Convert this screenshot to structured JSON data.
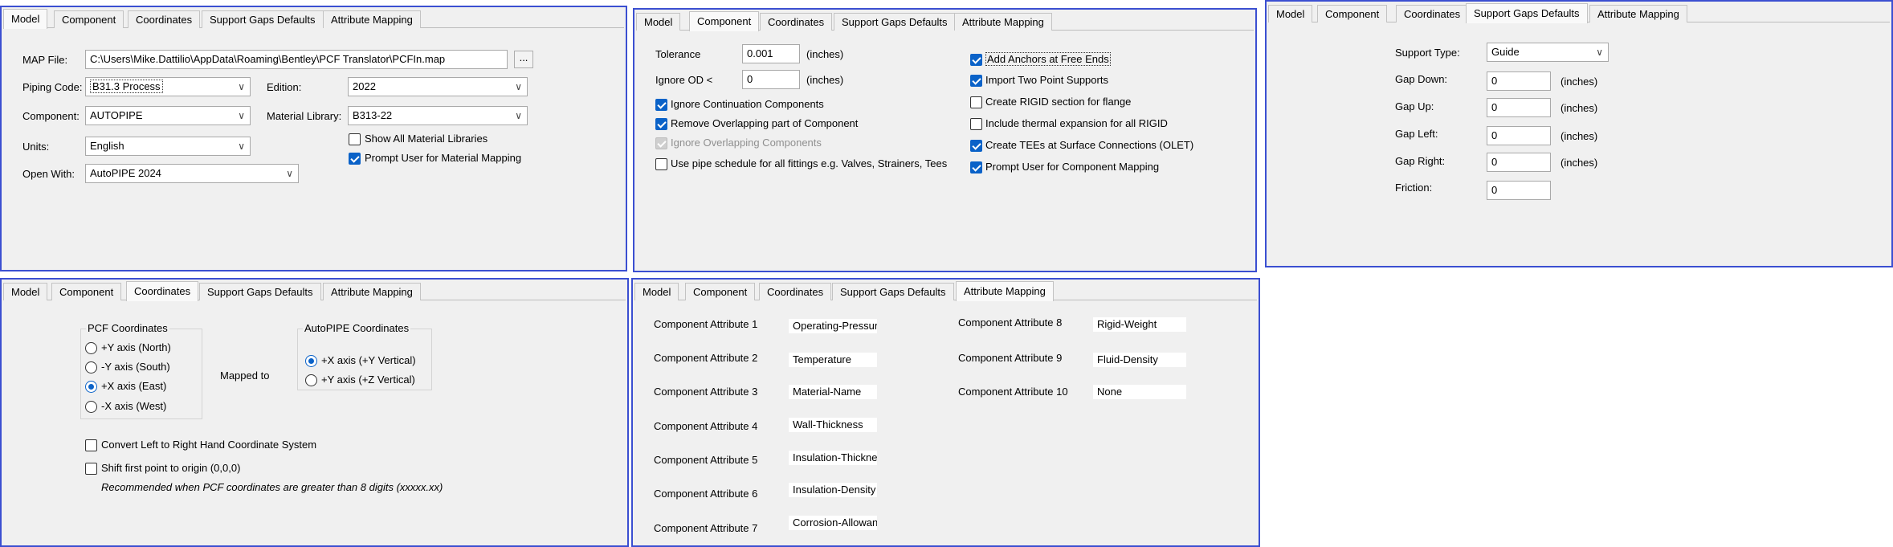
{
  "tabs": [
    "Model",
    "Component",
    "Coordinates",
    "Support Gaps Defaults",
    "Attribute Mapping"
  ],
  "model": {
    "map_file_label": "MAP File:",
    "map_file_value": "C:\\Users\\Mike.Dattilio\\AppData\\Roaming\\Bentley\\PCF Translator\\PCFIn.map",
    "browse_label": "...",
    "piping_code_label": "Piping Code:",
    "piping_code_value": "B31.3 Process",
    "edition_label": "Edition:",
    "edition_value": "2022",
    "component_label": "Component:",
    "component_value": "AUTOPIPE",
    "material_library_label": "Material Library:",
    "material_library_value": "B313-22",
    "units_label": "Units:",
    "units_value": "English",
    "show_all_libraries_label": "Show All Material Libraries",
    "show_all_libraries_checked": false,
    "prompt_material_label": "Prompt User for Material Mapping",
    "prompt_material_checked": true,
    "open_with_label": "Open With:",
    "open_with_value": "AutoPIPE 2024"
  },
  "component": {
    "tolerance_label": "Tolerance",
    "tolerance_value": "0.001",
    "tolerance_unit": "(inches)",
    "ignore_od_label": "Ignore OD <",
    "ignore_od_value": "0",
    "ignore_od_unit": "(inches)",
    "options_left": [
      {
        "label": "Ignore Continuation Components",
        "checked": true,
        "disabled": false
      },
      {
        "label": "Remove Overlapping part of Component",
        "checked": true,
        "disabled": false
      },
      {
        "label": "Ignore Overlapping Components",
        "checked": true,
        "disabled": true
      },
      {
        "label": "Use pipe schedule for all fittings e.g. Valves, Strainers, Tees",
        "checked": false,
        "disabled": false
      }
    ],
    "options_right": [
      {
        "label": "Add Anchors at Free Ends",
        "checked": true
      },
      {
        "label": "Import Two Point Supports",
        "checked": true
      },
      {
        "label": "Create RIGID section for flange",
        "checked": false
      },
      {
        "label": "Include thermal expansion for all RIGID",
        "checked": false
      },
      {
        "label": "Create TEEs at Surface Connections (OLET)",
        "checked": true
      },
      {
        "label": "Prompt User for Component Mapping",
        "checked": true
      }
    ]
  },
  "support": {
    "type_label": "Support Type:",
    "type_value": "Guide",
    "rows": [
      {
        "label": "Gap Down:",
        "value": "0",
        "unit": "(inches)"
      },
      {
        "label": "Gap Up:",
        "value": "0",
        "unit": "(inches)"
      },
      {
        "label": "Gap Left:",
        "value": "0",
        "unit": "(inches)"
      },
      {
        "label": "Gap Right:",
        "value": "0",
        "unit": "(inches)"
      },
      {
        "label": "Friction:",
        "value": "0",
        "unit": ""
      }
    ]
  },
  "coordinates": {
    "pcf_title": "PCF Coordinates",
    "pcf_options": [
      {
        "label": "+Y axis (North)",
        "selected": false
      },
      {
        "label": "-Y axis (South)",
        "selected": false
      },
      {
        "label": "+X axis (East)",
        "selected": true
      },
      {
        "label": "-X axis (West)",
        "selected": false
      }
    ],
    "mapped_to": "Mapped to",
    "autopipe_title": "AutoPIPE Coordinates",
    "autopipe_options": [
      {
        "label": "+X axis (+Y Vertical)",
        "selected": true
      },
      {
        "label": "+Y axis (+Z Vertical)",
        "selected": false
      }
    ],
    "convert_label": "Convert Left to Right Hand Coordinate System",
    "convert_checked": false,
    "shift_label": "Shift first point to origin (0,0,0)",
    "shift_checked": false,
    "shift_note": "Recommended when PCF coordinates are greater than 8 digits (xxxxx.xx)"
  },
  "attributes": {
    "left": [
      {
        "label": "Component Attribute 1",
        "value": "Operating-Pressure"
      },
      {
        "label": "Component Attribute 2",
        "value": "Temperature"
      },
      {
        "label": "Component Attribute 3",
        "value": "Material-Name"
      },
      {
        "label": "Component Attribute 4",
        "value": "Wall-Thickness"
      },
      {
        "label": "Component Attribute 5",
        "value": "Insulation-Thickness"
      },
      {
        "label": "Component Attribute 6",
        "value": "Insulation-Density"
      },
      {
        "label": "Component Attribute 7",
        "value": "Corrosion-Allowance"
      }
    ],
    "right": [
      {
        "label": "Component Attribute 8",
        "value": "Rigid-Weight"
      },
      {
        "label": "Component Attribute 9",
        "value": "Fluid-Density"
      },
      {
        "label": "Component Attribute 10",
        "value": "None"
      }
    ]
  },
  "colors": {
    "panel_border": "#3b4fd1",
    "panel_bg": "#f0f0f0",
    "check_blue": "#0a62c8"
  }
}
